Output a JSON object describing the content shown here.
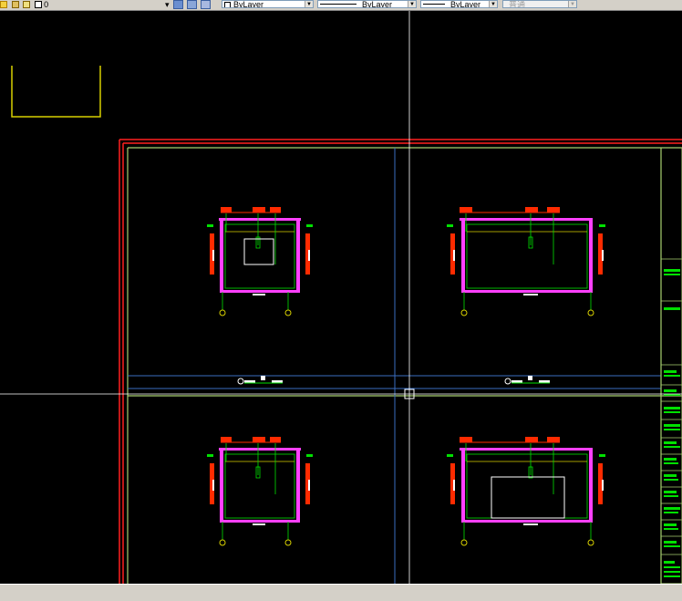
{
  "toolbar": {
    "layer_name": "0",
    "color_value": "ByLayer",
    "linetype_value": "ByLayer",
    "lineweight_value": "ByLayer",
    "plotstyle_value": "普通"
  },
  "colors": {
    "canvas_bg": "#000000",
    "frame_outer": "#ff2020",
    "frame_inner": "#a8d070",
    "viewport": "#3a6ec0",
    "crosshair": "#ffffff",
    "magenta": "#ff40ff",
    "wall": "#ff2b00",
    "green": "#00e000",
    "yellow": "#d8d000",
    "cyan": "#00c0ff"
  },
  "title_block_icons": [
    "text-fragment-icon"
  ],
  "canvas": {
    "plan_views": 4
  }
}
